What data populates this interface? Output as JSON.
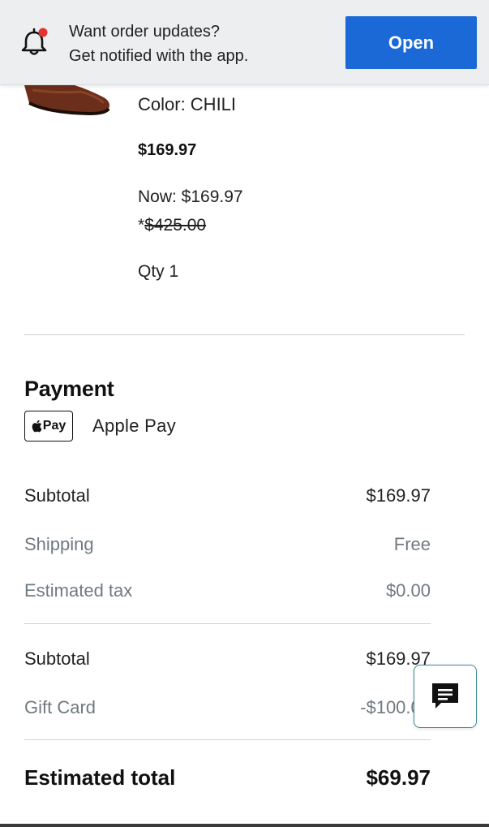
{
  "banner": {
    "line1": "Want order updates?",
    "line2": "Get notified with the app.",
    "open_label": "Open",
    "accent": "#1a69d6",
    "icon": "bell-notification-icon"
  },
  "product": {
    "color_line": "Color: CHILI",
    "price": "$169.97",
    "now_line": "Now: $169.97",
    "was_prefix": "*",
    "was_price": "$425.00",
    "qty_line": "Qty 1"
  },
  "payment": {
    "title": "Payment",
    "badge": "Pay",
    "method": "Apple Pay"
  },
  "summary": {
    "subtotal_label": "Subtotal",
    "subtotal_value": "$169.97",
    "shipping_label": "Shipping",
    "shipping_value": "Free",
    "tax_label": "Estimated tax",
    "tax_value": "$0.00",
    "subtotal2_label": "Subtotal",
    "subtotal2_value": "$169.97",
    "giftcard_label": "Gift Card",
    "giftcard_value": "-$100.00",
    "total_label": "Estimated total",
    "total_value": "$69.97"
  },
  "chat": {
    "icon": "chat-message-icon"
  }
}
